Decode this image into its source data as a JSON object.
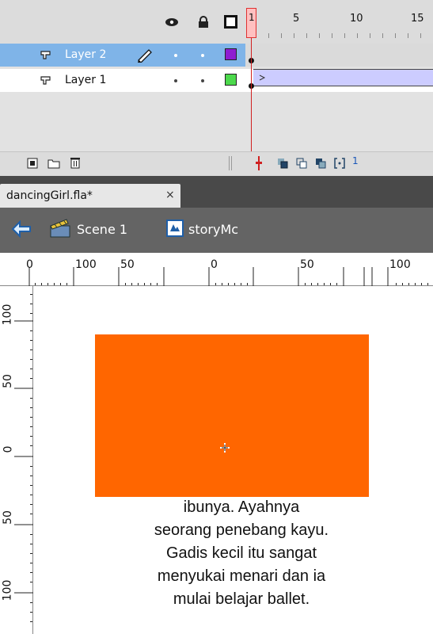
{
  "timeline": {
    "header_icons": [
      "eye-icon",
      "lock-icon",
      "outline-icon"
    ],
    "frame_numbers": [
      "1",
      "5",
      "10",
      "15"
    ],
    "current_frame": "1",
    "layers": [
      {
        "name": "Layer 2",
        "selected": true,
        "color": "#8e1cd1"
      },
      {
        "name": "Layer 1",
        "selected": false,
        "color": "#4cd94c"
      }
    ],
    "footer": {
      "frame_indicator": "1"
    }
  },
  "document": {
    "tab_label": "dancingGirl.fla*",
    "close_glyph": "×"
  },
  "breadcrumb": {
    "scene": "Scene 1",
    "symbol": "storyMc"
  },
  "rulers": {
    "horizontal": [
      "0",
      "100",
      "50",
      "0",
      "50",
      "100"
    ],
    "vertical": [
      "100",
      "50",
      "0",
      "50",
      "100"
    ]
  },
  "stage": {
    "rect_color": "#ff6600",
    "story_lines": [
      "ibunya. Ayahnya",
      "seorang penebang kayu.",
      "Gadis kecil itu sangat",
      "menyukai menari dan ia",
      "mulai belajar ballet."
    ]
  }
}
